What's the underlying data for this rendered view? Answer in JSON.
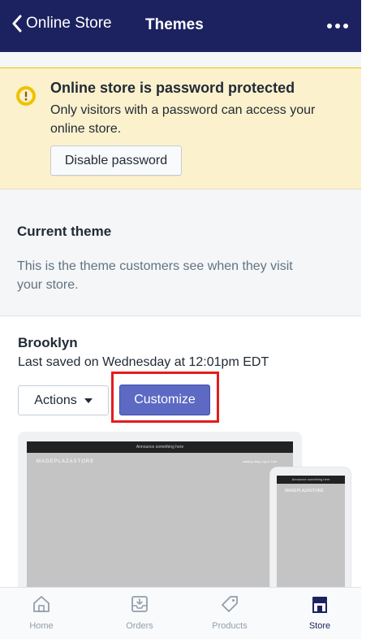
{
  "nav": {
    "back_label": "Online Store",
    "title": "Themes"
  },
  "banner": {
    "title": "Online store is password protected",
    "body": "Only visitors with a password can access your online store.",
    "button_label": "Disable password"
  },
  "current_theme": {
    "heading": "Current theme",
    "description": "This is the theme customers see when they visit your store."
  },
  "theme_card": {
    "name": "Brooklyn",
    "saved_text": "Last saved on Wednesday at 12:01pm EDT",
    "actions_label": "Actions",
    "customize_label": "Customize"
  },
  "preview": {
    "announcement": "Announce something here",
    "logo": "MAGEPLAZASTORE",
    "nav": "catalog   blog   Log in   Cart"
  },
  "tabs": [
    {
      "label": "Home",
      "icon": "home-icon"
    },
    {
      "label": "Orders",
      "icon": "orders-icon"
    },
    {
      "label": "Products",
      "icon": "tag-icon"
    },
    {
      "label": "Store",
      "icon": "store-icon"
    }
  ],
  "colors": {
    "nav_bg": "#1c2260",
    "banner_bg": "#fcf1cd",
    "accent": "#5c6ac4",
    "highlight": "#e51c1c"
  }
}
